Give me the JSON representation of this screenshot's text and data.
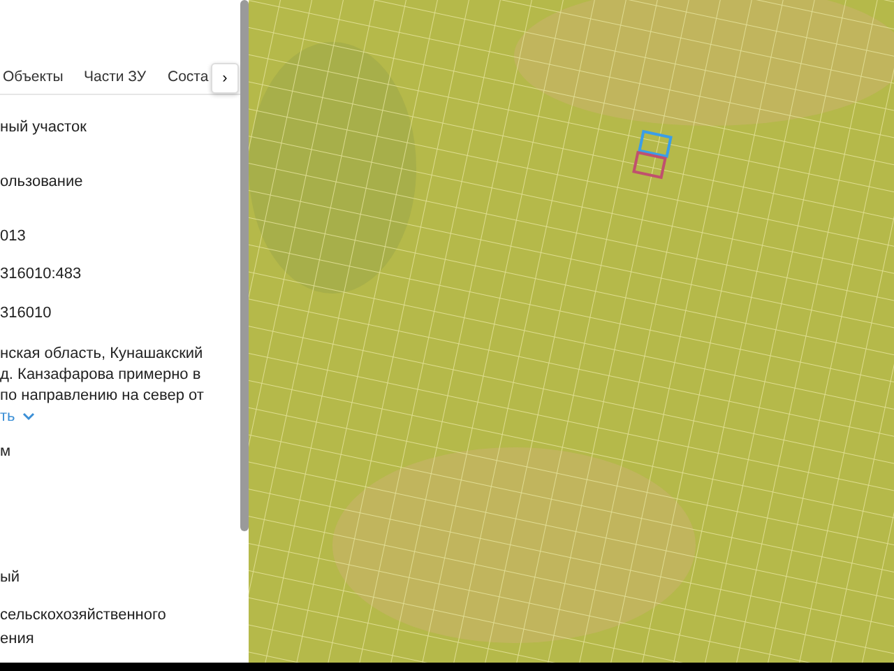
{
  "tabs": [
    {
      "label": "Объекты"
    },
    {
      "label": "Части ЗУ"
    },
    {
      "label": "Соста"
    }
  ],
  "tabs_next_button": "›",
  "fields": [
    {
      "lines": [
        "ный участок"
      ]
    },
    {
      "lines": [
        "ользование"
      ]
    },
    {
      "lines": [
        "013"
      ]
    },
    {
      "lines": [
        "316010:483"
      ]
    },
    {
      "lines": [
        "316010"
      ]
    },
    {
      "lines": [
        "нская область, Кунашакский",
        "д. Канзафарова примерно в",
        "по направлению на север от"
      ],
      "link": "ть"
    },
    {
      "lines": [
        "м"
      ]
    },
    {
      "lines": [
        "ый"
      ]
    },
    {
      "lines": [
        "сельскохозяйственного",
        "ения"
      ]
    }
  ],
  "map": {
    "parcels": [
      {
        "color": "#3a9ee8"
      },
      {
        "color": "#c0506e"
      }
    ]
  }
}
